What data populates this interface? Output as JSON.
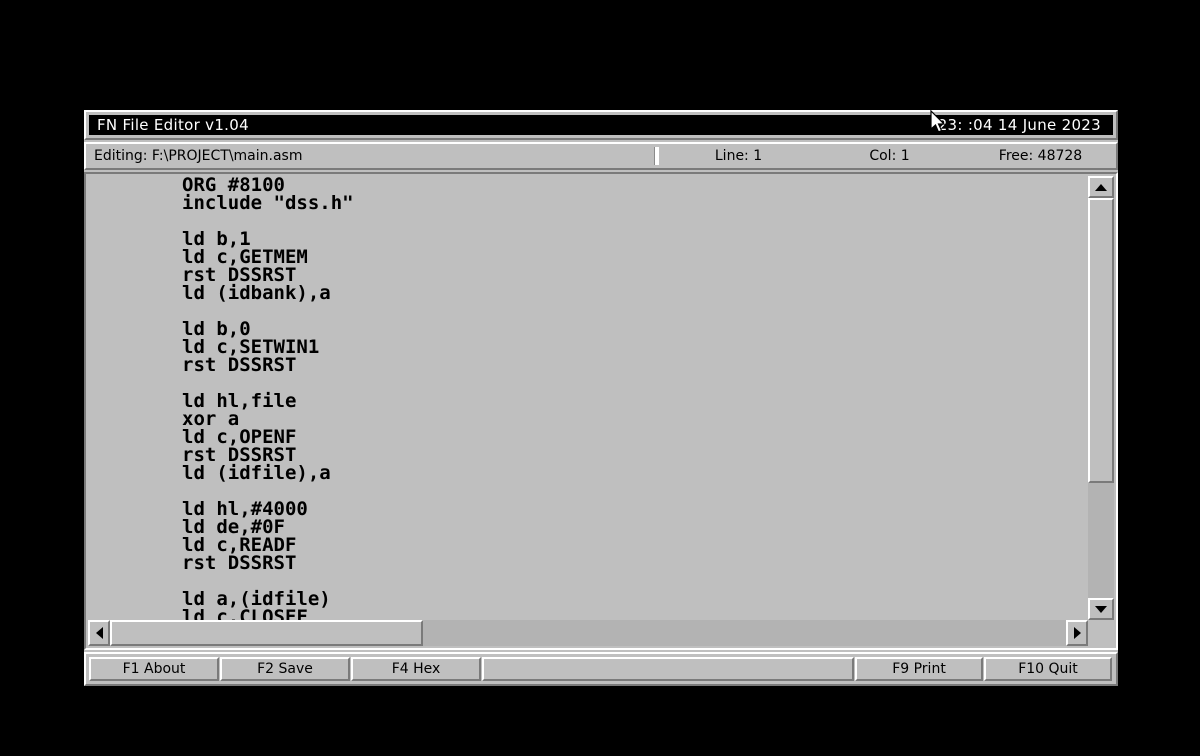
{
  "window": {
    "title": "FN File Editor v1.04",
    "clock": "23:  :04  14 June 2023"
  },
  "status": {
    "file_label": "Editing: F:\\PROJECT\\main.asm",
    "line": "Line: 1",
    "col": "Col: 1",
    "free": "Free: 48728"
  },
  "editor": {
    "lines": [
      "ORG #8100",
      "include \"dss.h\"",
      "",
      "ld b,1",
      "ld c,GETMEM",
      "rst DSSRST",
      "ld (idbank),a",
      "",
      "ld b,0",
      "ld c,SETWIN1",
      "rst DSSRST",
      "",
      "ld hl,file",
      "xor a",
      "ld c,OPENF",
      "rst DSSRST",
      "ld (idfile),a",
      "",
      "ld hl,#4000",
      "ld de,#0F",
      "ld c,READF",
      "rst DSSRST",
      "",
      "ld a,(idfile)",
      "ld c,CLOSEF"
    ]
  },
  "function_bar": {
    "keys": [
      {
        "label": "F1 About"
      },
      {
        "label": "F2 Save"
      },
      {
        "label": "F4 Hex"
      },
      {
        "label": ""
      },
      {
        "label": "F9 Print"
      },
      {
        "label": "F10 Quit"
      }
    ]
  },
  "colors": {
    "face": "#bfbfbf",
    "shadow": "#7a7a7a",
    "highlight": "#ffffff",
    "titlebar_bg": "#000000",
    "titlebar_fg": "#ffffff",
    "text": "#000000",
    "backdrop": "#000000"
  }
}
